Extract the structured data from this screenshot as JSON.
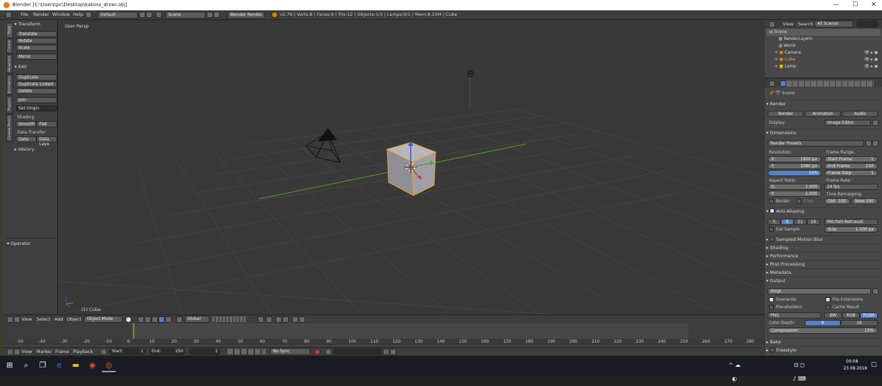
{
  "window": {
    "title": "Blender [C:\\Users\\pc\\Desktop\\kabina_drzwi.obj]",
    "min": "—",
    "max": "☐",
    "close": "✕"
  },
  "topbar": {
    "menus": [
      "File",
      "Render",
      "Window",
      "Help"
    ],
    "layout": "Default",
    "scene": "Scene",
    "engine": "Blender Render",
    "stats": "v2.79 | Verts:8 | Faces:6 | Tris:12 | Objects:1/3 | Lamps:0/1 | Mem:8.15M | Cube"
  },
  "toolshelf": {
    "tabs": [
      "Tools",
      "Create",
      "Relations",
      "Animation",
      "Physics",
      "Grease Pencil"
    ],
    "transform_header": "Transform",
    "transform": [
      "Translate",
      "Rotate",
      "Scale"
    ],
    "mirror": "Mirror",
    "edit_header": "Edit",
    "edit": [
      "Duplicate",
      "Duplicate Linked",
      "Delete"
    ],
    "join": "Join",
    "set_origin": "Set Origin",
    "shading_label": "Shading:",
    "smooth": "Smooth",
    "flat": "Flat",
    "data_transfer_label": "Data Transfer:",
    "data": "Data",
    "data_layo": "Data Layo",
    "history": "History",
    "operator": "Operator"
  },
  "viewport": {
    "label": "User Persp",
    "object": "(1) Cube"
  },
  "vp_header": {
    "menus": [
      "View",
      "Select",
      "Add",
      "Object"
    ],
    "mode": "Object Mode",
    "orientation": "Global"
  },
  "timeline": {
    "ticks": [
      "-50",
      "-40",
      "-30",
      "-20",
      "-10",
      "0",
      "10",
      "20",
      "30",
      "40",
      "50",
      "60",
      "70",
      "80",
      "90",
      "100",
      "110",
      "120",
      "130",
      "140",
      "150",
      "160",
      "170",
      "180",
      "190",
      "200",
      "210",
      "220",
      "230",
      "240",
      "250",
      "260",
      "270",
      "280"
    ],
    "menus": [
      "View",
      "Marker",
      "Frame",
      "Playback"
    ],
    "start_label": "Start:",
    "start": "1",
    "end_label": "End:",
    "end": "250",
    "current": "1",
    "sync": "No Sync"
  },
  "outliner": {
    "menus": [
      "View",
      "Search"
    ],
    "filter": "All Scenes",
    "rows": [
      "Scene",
      "RenderLayers",
      "World",
      "Camera",
      "Cube",
      "Lamp"
    ]
  },
  "properties": {
    "context": "Scene",
    "render_header": "Render",
    "render_btns": [
      "Render",
      "Animation",
      "Audio"
    ],
    "display_label": "Display:",
    "display": "Image Editor",
    "dimensions_header": "Dimensions",
    "presets": "Render Presets",
    "resolution_label": "Resolution:",
    "res_x_label": "X:",
    "res_x": "1920 px",
    "res_y_label": "Y:",
    "res_y": "1080 px",
    "res_pct": "50%",
    "frame_range_label": "Frame Range:",
    "start_frame_label": "Start Frame:",
    "start_frame": "1",
    "end_frame_label": "End Frame:",
    "end_frame": "250",
    "frame_step_label": "Frame Step:",
    "frame_step": "1",
    "aspect_label": "Aspect Ratio:",
    "asp_x_label": "X:",
    "asp_x": "1.000",
    "asp_y_label": "Y:",
    "asp_y": "1.000",
    "frame_rate_label": "Frame Rate:",
    "fps": "24 fps",
    "remap_label": "Time Remapping:",
    "old_label": "Old:",
    "old": "100",
    "new_label": "New:",
    "new": "100",
    "border": "Border",
    "crop": "Crop",
    "aa_header": "Anti-Aliasing",
    "aa_samples": [
      "5",
      "8",
      "11",
      "16"
    ],
    "aa_filter": "Mitchell-Netravali",
    "full_sample": "Full Sample",
    "size_label": "Size:",
    "size": "1.000 px",
    "motion_blur": "Sampled Motion Blur",
    "collapsed": [
      "Shading",
      "Performance",
      "Post Processing",
      "Metadata"
    ],
    "output_header": "Output",
    "output_path": "/tmp\\",
    "overwrite": "Overwrite",
    "file_ext": "File Extensions",
    "placeholders": "Placeholders",
    "cache_result": "Cache Result",
    "format": "PNG",
    "color_modes": [
      "BW",
      "RGB",
      "RGBA"
    ],
    "color_depth_label": "Color Depth:",
    "depths": [
      "8",
      "16"
    ],
    "compression_label": "Compression:",
    "compression": "15%",
    "bake": "Bake",
    "freestyle": "Freestyle"
  },
  "taskbar": {
    "time": "00:08",
    "date": "23.08.2018"
  },
  "colors": {
    "accent": "#5680c2",
    "blender_orange": "#e87d0d",
    "x_axis": "#c23b3b",
    "y_axis": "#5ba02c",
    "selection": "#f5a623"
  }
}
